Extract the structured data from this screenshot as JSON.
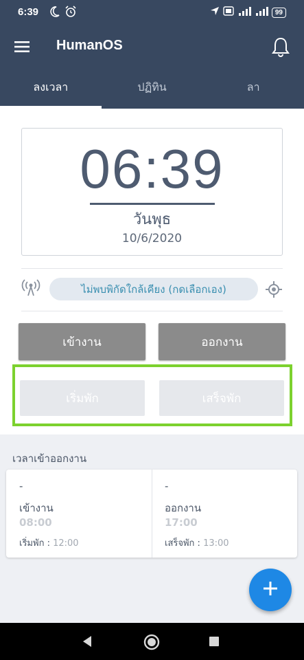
{
  "status_bar": {
    "time": "6:39",
    "battery": "99"
  },
  "app_bar": {
    "title": "HumanOS"
  },
  "tabs": [
    {
      "label": "ลงเวลา",
      "active": true
    },
    {
      "label": "ปฏิทิน",
      "active": false
    },
    {
      "label": "ลา",
      "active": false
    }
  ],
  "clock": {
    "time": "06:39",
    "day": "วันพุธ",
    "date": "10/6/2020"
  },
  "location": {
    "text": "ไม่พบพิกัดใกล้เคียง (กดเลือกเอง)"
  },
  "buttons": {
    "check_in": "เข้างาน",
    "check_out": "ออกงาน",
    "break_start": "เริ่มพัก",
    "break_end": "เสร็จพัก"
  },
  "work_hours": {
    "title": "เวลาเข้าออกงาน",
    "check_in": {
      "dash": "-",
      "label": "เข้างาน",
      "time": "08:00",
      "break_label": "เริ่มพัก :",
      "break_time": "12:00"
    },
    "check_out": {
      "dash": "-",
      "label": "ออกงาน",
      "time": "17:00",
      "break_label": "เสร็จพัก :",
      "break_time": "13:00"
    }
  },
  "colors": {
    "header": "#384860",
    "highlight": "#7cd12e",
    "fab": "#1e88e5",
    "location_text": "#3a8fb0"
  }
}
